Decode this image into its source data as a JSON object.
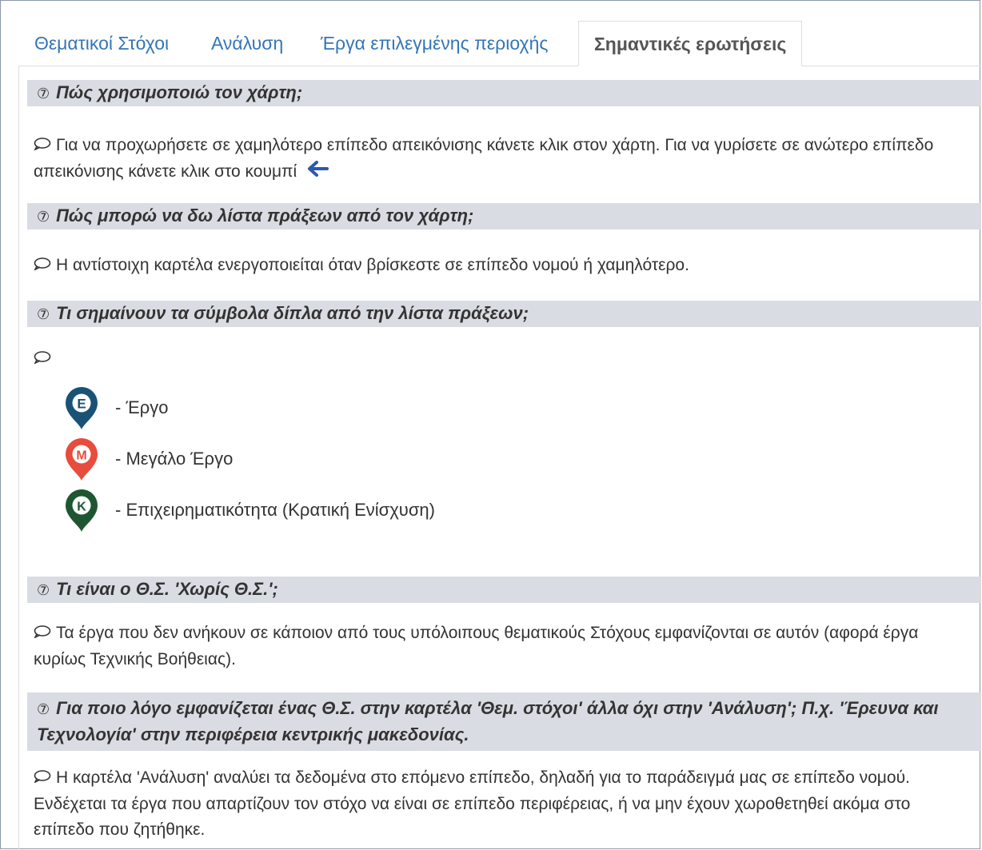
{
  "tabs": [
    {
      "label": "Θεματικοί Στόχοι"
    },
    {
      "label": "Ανάλυση"
    },
    {
      "label": "Έργα επιλεγμένης περιοχής"
    },
    {
      "label": "Σημαντικές ερωτήσεις"
    }
  ],
  "faq": [
    {
      "question": "Πώς χρησιμοποιώ τον χάρτη;",
      "answer": "Για να προχωρήσετε σε χαμηλότερο επίπεδο απεικόνισης κάνετε κλικ στον χάρτη. Για να γυρίσετε σε ανώτερο επίπεδο απεικόνισης κάνετε κλικ στο κουμπί"
    },
    {
      "question": "Πώς μπορώ να δω λίστα πράξεων από τον χάρτη;",
      "answer": "Η αντίστοιχη καρτέλα ενεργοποιείται όταν βρίσκεστε σε επίπεδο νομού ή χαμηλότερο."
    },
    {
      "question": "Τι σημαίνουν τα σύμβολα δίπλα από την λίστα πράξεων;",
      "answer": ""
    },
    {
      "question": "Τι είναι ο Θ.Σ. 'Χωρίς Θ.Σ.';",
      "answer": "Τα έργα που δεν ανήκουν σε κάποιον από τους υπόλοιπους θεματικούς Στόχους εμφανίζονται σε αυτόν (αφορά έργα κυρίως Τεχνικής Βοήθειας)."
    },
    {
      "question": "Για ποιο λόγο εμφανίζεται ένας Θ.Σ. στην καρτέλα 'Θεμ. στόχοι' άλλα όχι στην 'Ανάλυση'; Π.χ. 'Έρευνα και Τεχνολογία' στην περιφέρεια κεντρικής μακεδονίας.",
      "answer": "Η καρτέλα 'Ανάλυση' αναλύει τα δεδομένα στο επόμενο επίπεδο, δηλαδή για το παράδειγμά μας σε επίπεδο νομού. Ενδέχεται τα έργα που απαρτίζουν τον στόχο να είναι σε επίπεδο περιφέρειας, ή να μην έχουν χωροθετηθεί ακόμα στο επίπεδο που ζητήθηκε."
    }
  ],
  "legend": [
    {
      "letter": "E",
      "label": "- Έργο",
      "color": "#1a5276",
      "icon": "project-marker-icon"
    },
    {
      "letter": "M",
      "label": "- Μεγάλο Έργο",
      "color": "#e74c3c",
      "icon": "major-project-marker-icon"
    },
    {
      "letter": "K",
      "label": "- Επιχειρηματικότητα (Κρατική Ενίσχυση)",
      "color": "#1e5631",
      "icon": "state-aid-marker-icon"
    }
  ],
  "colors": {
    "link": "#3476b6",
    "question_bg": "#d9dce2",
    "arrow": "#2a5aa8"
  }
}
